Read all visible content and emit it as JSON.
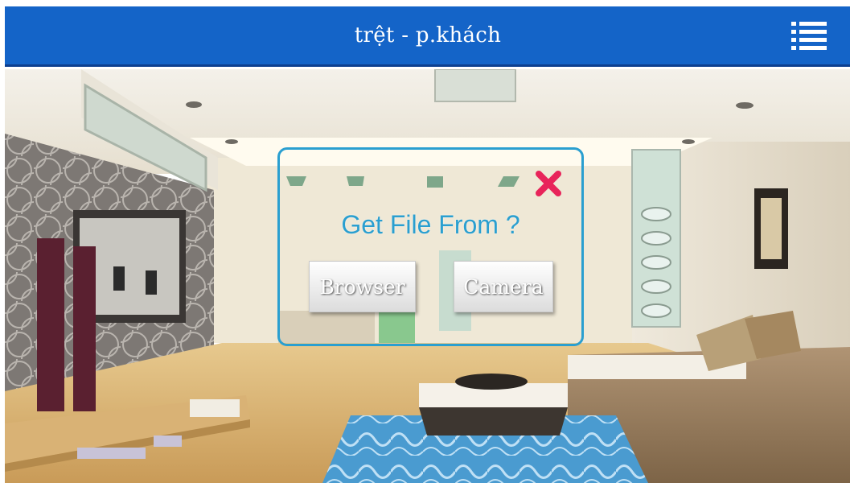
{
  "header": {
    "title": "trệt - p.khách",
    "menu_icon": "list-menu-icon",
    "bar_color": "#1464c8"
  },
  "dialog": {
    "title": "Get File From ?",
    "close_icon": "close-x-icon",
    "close_color": "#e8245a",
    "accent_color": "#2a9fd0",
    "browser_label": "Browser",
    "camera_label": "Camera"
  },
  "background": {
    "description_icon": "living-room-photo"
  }
}
